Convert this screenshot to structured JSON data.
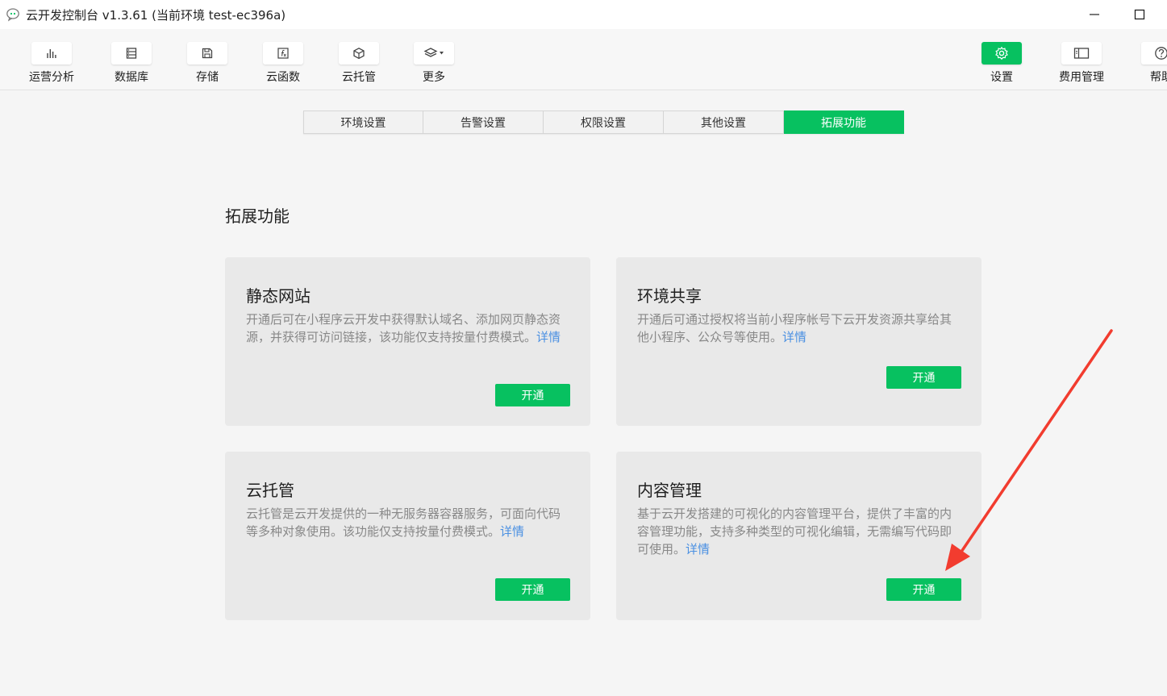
{
  "window": {
    "title": "云开发控制台 v1.3.61  (当前环境 test-ec396a)",
    "icons": {
      "app": "wechat-devtools-icon",
      "minimize": "minimize-icon",
      "maximize": "maximize-icon"
    }
  },
  "toolbar": {
    "left": [
      {
        "label": "运营分析",
        "icon": "bar-chart-icon"
      },
      {
        "label": "数据库",
        "icon": "database-icon"
      },
      {
        "label": "存储",
        "icon": "floppy-disk-icon"
      },
      {
        "label": "云函数",
        "icon": "function-icon"
      },
      {
        "label": "云托管",
        "icon": "cube-icon"
      },
      {
        "label": "更多",
        "icon": "layers-icon"
      }
    ],
    "right": [
      {
        "label": "设置",
        "icon": "gear-icon",
        "active": true
      },
      {
        "label": "费用管理",
        "icon": "billing-icon"
      },
      {
        "label": "帮助",
        "icon": "help-icon"
      }
    ]
  },
  "tabs": [
    {
      "label": "环境设置"
    },
    {
      "label": "告警设置"
    },
    {
      "label": "权限设置"
    },
    {
      "label": "其他设置"
    },
    {
      "label": "拓展功能",
      "active": true
    }
  ],
  "section": {
    "title": "拓展功能"
  },
  "cards": [
    {
      "title": "静态网站",
      "desc": "开通后可在小程序云开发中获得默认域名、添加网页静态资源，并获得可访问链接，该功能仅支持按量付费模式。",
      "link": "详情",
      "button": "开通"
    },
    {
      "title": "环境共享",
      "desc": "开通后可通过授权将当前小程序帐号下云开发资源共享给其他小程序、公众号等使用。",
      "link": "详情",
      "button": "开通"
    },
    {
      "title": "云托管",
      "desc": "云托管是云开发提供的一种无服务器容器服务，可面向代码等多种对象使用。该功能仅支持按量付费模式。",
      "link": "详情",
      "button": "开通"
    },
    {
      "title": "内容管理",
      "desc": "基于云开发搭建的可视化的内容管理平台，提供了丰富的内容管理功能，支持多种类型的可视化编辑，无需编写代码即可使用。",
      "link": "详情",
      "button": "开通"
    }
  ],
  "colors": {
    "accent": "#07c160",
    "link": "#4a90e2",
    "annotation": "#f23c2f"
  },
  "annotation": {
    "type": "red-arrow",
    "points_to": "内容管理 开通"
  }
}
